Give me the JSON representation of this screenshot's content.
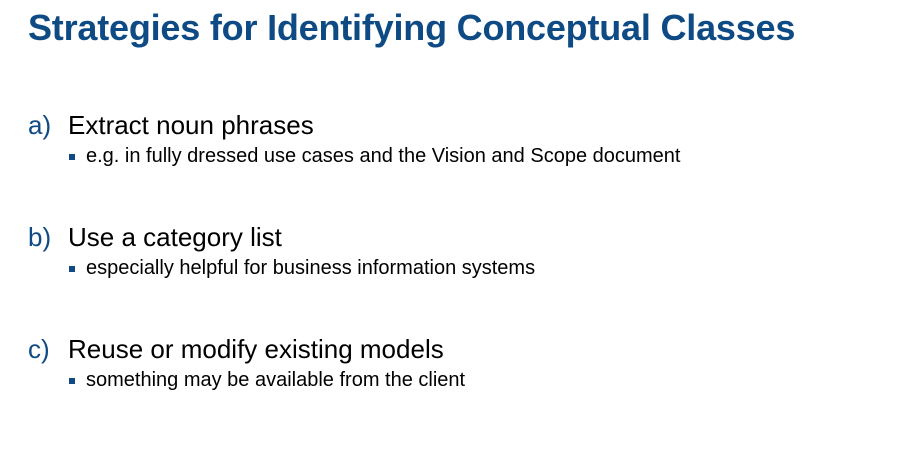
{
  "slide": {
    "title": "Strategies for Identifying Conceptual Classes",
    "strategies": [
      {
        "marker": "a)",
        "heading": "Extract noun phrases",
        "bullet": "e.g. in fully dressed use cases and the Vision and Scope document"
      },
      {
        "marker": "b)",
        "heading": "Use a category list",
        "bullet": "especially helpful for business information systems"
      },
      {
        "marker": "c)",
        "heading": "Reuse or modify existing models",
        "bullet": "something may be available from the client"
      }
    ]
  },
  "colors": {
    "title": "#0e4a84",
    "marker": "#0e4a84",
    "bullet_square": "#0e4a84",
    "body_text": "#000000",
    "background": "#ffffff"
  }
}
